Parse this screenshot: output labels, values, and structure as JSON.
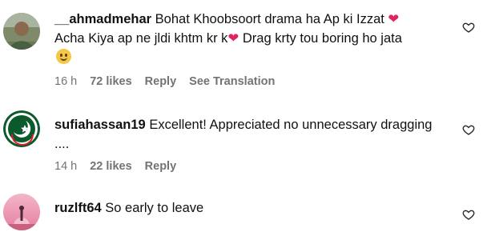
{
  "comments": [
    {
      "username": "__ahmadmehar",
      "text_1": "Bohat Khoobsoort drama ha Ap ki Izzat",
      "text_2": "Acha Kiya ap ne jldi khtm kr k",
      "text_3": "Drag krty tou boring ho jata",
      "time": "16 h",
      "likes": "72 likes",
      "reply": "Reply",
      "translation": "See Translation"
    },
    {
      "username": "sufiahassan19",
      "text_1": "Excellent! Appreciated no unnecessary dragging",
      "text_2": "....",
      "time": "14 h",
      "likes": "22 likes",
      "reply": "Reply"
    },
    {
      "username": "ruzlft64",
      "text_1": "So early to leave"
    }
  ],
  "colors": {
    "meta": "#737373",
    "heart_emoji": "#e0245e",
    "flag_green": "#0b5a2b"
  },
  "icons": [
    "heart-outline-icon",
    "red-heart-emoji",
    "smiling-face-emoji"
  ]
}
